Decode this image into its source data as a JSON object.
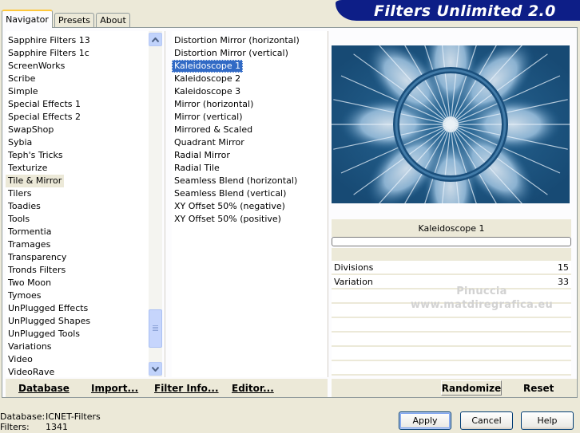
{
  "tabs": [
    {
      "label": "Navigator",
      "active": true
    },
    {
      "label": "Presets",
      "active": false
    },
    {
      "label": "About",
      "active": false
    }
  ],
  "banner": {
    "title": "Filters Unlimited 2.0",
    "color": "#0d1e87"
  },
  "categories": {
    "items": [
      "Sapphire Filters 13",
      "Sapphire Filters 1c",
      "ScreenWorks",
      "Scribe",
      "Simple",
      "Special Effects 1",
      "Special Effects 2",
      "SwapShop",
      "Sybia",
      "Teph's Tricks",
      "Texturize",
      "Tile & Mirror",
      "Tilers",
      "Toadies",
      "Tools",
      "Tormentia",
      "Tramages",
      "Transparency",
      "Tronds Filters",
      "Two Moon",
      "Tymoes",
      "UnPlugged Effects",
      "UnPlugged Shapes",
      "UnPlugged Tools",
      "Variations",
      "Video",
      "VideoRave"
    ],
    "selected": "Tile & Mirror",
    "scroll_up_icon": "arrow-up-icon",
    "scroll_down_icon": "arrow-down-icon"
  },
  "filters": {
    "items": [
      "Distortion Mirror (horizontal)",
      "Distortion Mirror (vertical)",
      "Kaleidoscope 1",
      "Kaleidoscope 2",
      "Kaleidoscope 3",
      "Mirror (horizontal)",
      "Mirror (vertical)",
      "Mirrored & Scaled",
      "Quadrant Mirror",
      "Radial Mirror",
      "Radial Tile",
      "Seamless Blend (horizontal)",
      "Seamless Blend (vertical)",
      "XY Offset 50% (negative)",
      "XY Offset 50% (positive)"
    ],
    "selected": "Kaleidoscope 1"
  },
  "preview": {
    "filter_name": "Kaleidoscope 1",
    "base_color": "#1b5480"
  },
  "parameters": [
    {
      "label": "Divisions",
      "value": "15"
    },
    {
      "label": "Variation",
      "value": "33"
    }
  ],
  "watermark": {
    "line1": "Pinuccia",
    "line2": "www.matdiregrafica.eu"
  },
  "left_actions": {
    "database": "Database",
    "import": "Import...",
    "filter_info": "Filter Info...",
    "editor": "Editor..."
  },
  "right_actions": {
    "randomize": "Randomize",
    "reset": "Reset"
  },
  "status": {
    "database_label": "Database:",
    "database_value": "ICNET-Filters",
    "filters_label": "Filters:",
    "filters_value": "1341"
  },
  "dialog_buttons": {
    "apply": "Apply",
    "cancel": "Cancel",
    "help": "Help"
  }
}
